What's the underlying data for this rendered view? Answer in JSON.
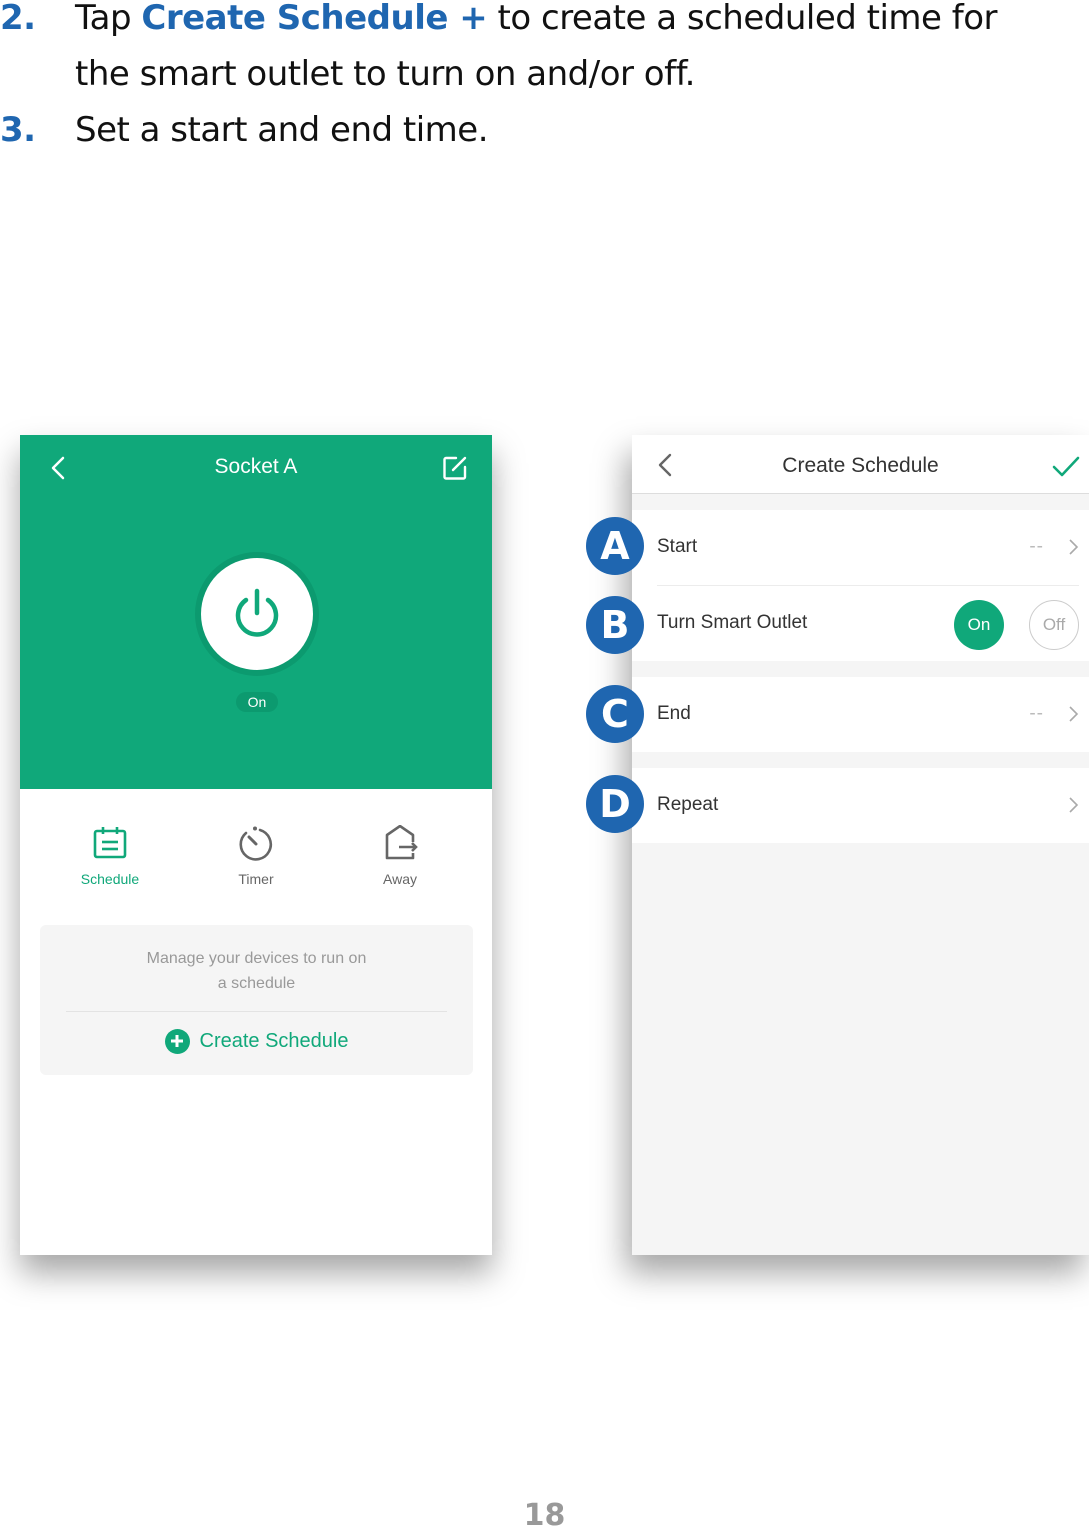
{
  "instructions": {
    "steps": [
      {
        "number": "2.",
        "text_before": "Tap ",
        "highlight": "Create Schedule +",
        "text_after": " to create a scheduled time for",
        "continuation": "the smart outlet to turn on and/or off."
      },
      {
        "number": "3.",
        "text": "Set a start and end time."
      }
    ]
  },
  "colors": {
    "brand_green": "#10a87a",
    "annotation_blue": "#1f66b0"
  },
  "left_screen": {
    "title": "Socket A",
    "back_icon": "chevron-left-icon",
    "edit_icon": "edit-icon",
    "power_icon": "power-icon",
    "power_state": "On",
    "tabs": [
      {
        "label": "Schedule",
        "icon": "calendar-icon",
        "active": true
      },
      {
        "label": "Timer",
        "icon": "timer-icon",
        "active": false
      },
      {
        "label": "Away",
        "icon": "away-icon",
        "active": false
      }
    ],
    "empty_state": {
      "message_line1": "Manage your devices to run on",
      "message_line2": "a schedule",
      "create_label": "Create Schedule",
      "create_icon": "plus-circle-icon"
    }
  },
  "right_screen": {
    "title": "Create Schedule",
    "back_icon": "chevron-left-icon",
    "confirm_icon": "check-icon",
    "rows": {
      "start": {
        "label": "Start",
        "value": "--"
      },
      "turn": {
        "label": "Turn Smart Outlet",
        "on_label": "On",
        "off_label": "Off",
        "selected": "On"
      },
      "end": {
        "label": "End",
        "value": "--"
      },
      "repeat": {
        "label": "Repeat",
        "value": ""
      }
    }
  },
  "annotations": [
    "A",
    "B",
    "C",
    "D"
  ],
  "page_number": "18"
}
